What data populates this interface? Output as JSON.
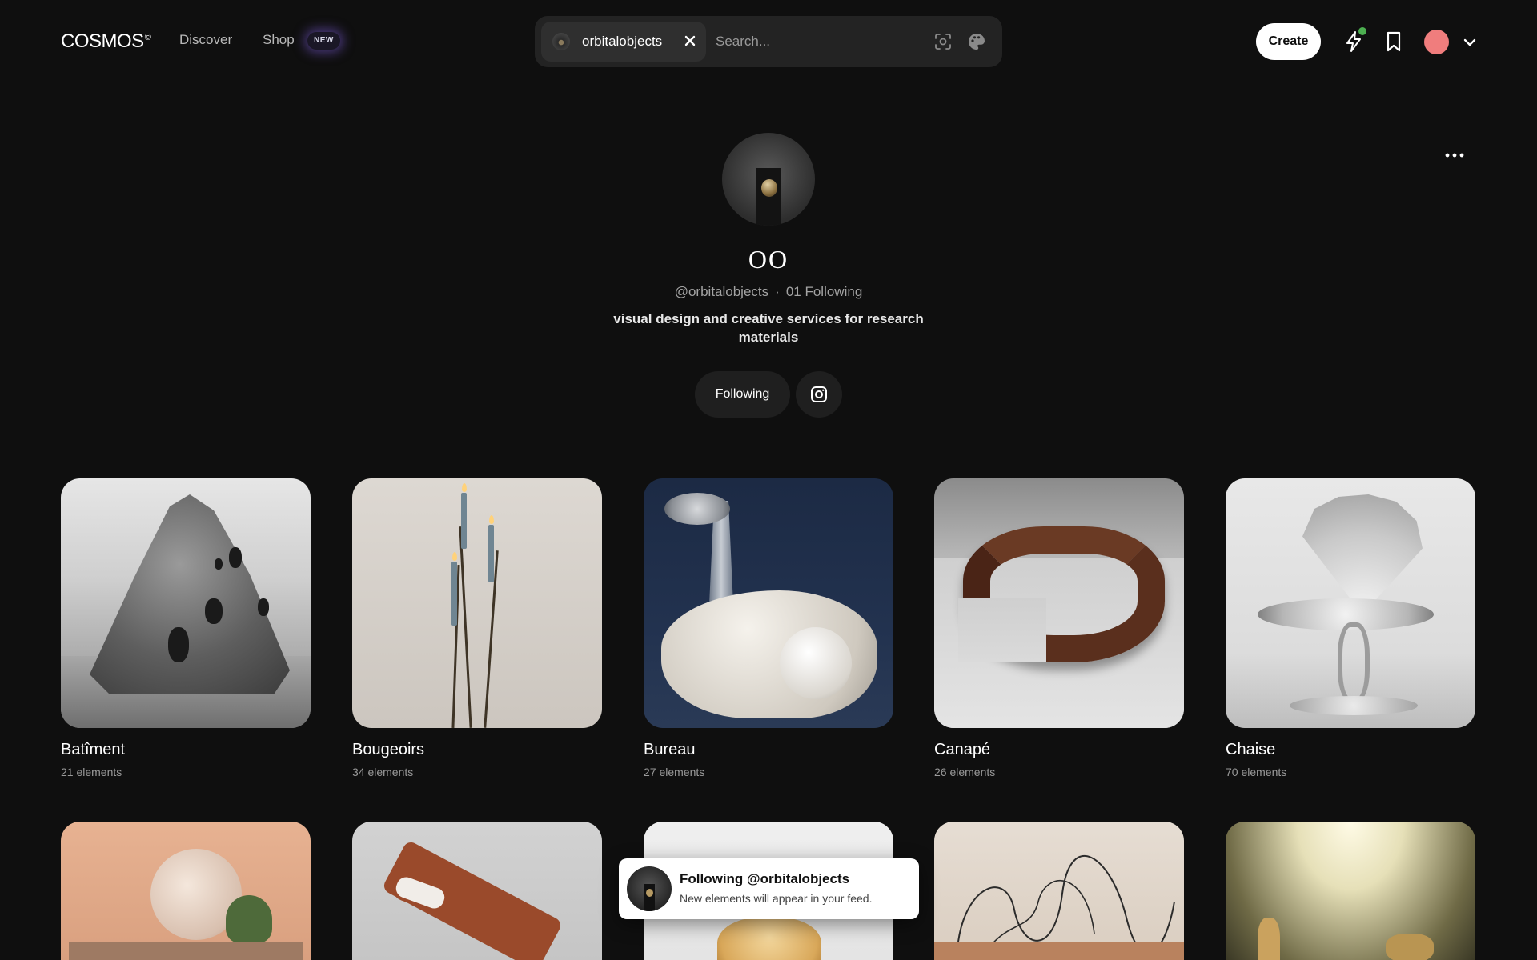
{
  "nav": {
    "logo": "COSMOS",
    "logo_mark": "©",
    "discover": "Discover",
    "shop": "Shop",
    "shop_badge": "NEW",
    "create": "Create"
  },
  "search": {
    "chip_label": "orbitalobjects",
    "placeholder": "Search..."
  },
  "profile": {
    "name": "OO",
    "handle": "@orbitalobjects",
    "separator": "·",
    "following_count": "01 Following",
    "bio": "visual design and creative services for research materials",
    "following_button": "Following"
  },
  "collections": [
    {
      "title": "Batîment",
      "count": "21 elements"
    },
    {
      "title": "Bougeoirs",
      "count": "34 elements"
    },
    {
      "title": "Bureau",
      "count": "27 elements"
    },
    {
      "title": "Canapé",
      "count": "26 elements"
    },
    {
      "title": "Chaise",
      "count": "70 elements"
    }
  ],
  "toast": {
    "title": "Following @orbitalobjects",
    "subtitle": "New elements will appear in your feed."
  },
  "icons": {
    "chip_close": "close-icon",
    "visual_search": "scan-icon",
    "palette": "palette-icon",
    "activity": "lightning-icon",
    "saved": "bookmark-icon",
    "account_menu": "chevron-down-icon",
    "more": "more-horizontal-icon",
    "social": "instagram-icon"
  },
  "colors": {
    "background": "#0f0f0f",
    "avatar": "#f07d7d",
    "notification_dot": "#4caf50",
    "badge_glow": "#785ad2"
  }
}
